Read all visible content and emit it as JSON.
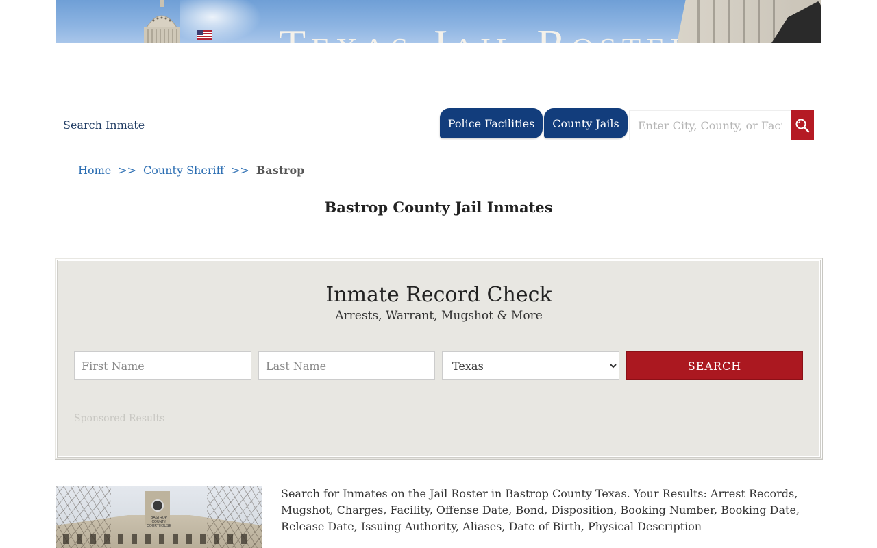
{
  "banner": {
    "title": "Texas Jail Roster"
  },
  "nav": {
    "search_inmate": "Search Inmate",
    "tabs": [
      {
        "label": "Police Facilities"
      },
      {
        "label": "County Jails"
      }
    ],
    "site_search_placeholder": "Enter City, County, or Facility"
  },
  "breadcrumb": {
    "home": "Home",
    "sep1": ">>",
    "county_sheriff": "County Sheriff",
    "sep2": ">>",
    "current": "Bastrop"
  },
  "page": {
    "title": "Bastrop County Jail Inmates"
  },
  "record_check": {
    "title": "Inmate Record Check",
    "subtitle": "Arrests, Warrant, Mugshot & More",
    "first_name_placeholder": "First Name",
    "last_name_placeholder": "Last Name",
    "state_selected": "Texas",
    "search_label": "SEARCH",
    "sponsored": "Sponsored Results"
  },
  "content": {
    "photo_sign": "BASTROP COUNTY COURTHOUSE",
    "description": "Search for Inmates on the Jail Roster in Bastrop County Texas. Your Results: Arrest Records, Mugshot, Charges, Facility, Offense Date, Bond, Disposition, Booking Number, Booking Date, Release Date, Issuing Authority, Aliases, Date of Birth, Physical Description"
  },
  "colors": {
    "nav_blue": "#123d7c",
    "accent_red": "#ab1820",
    "link_blue": "#2d6fb3",
    "panel_bg": "#e8e7e2"
  },
  "icons": {
    "site_search": "search-icon"
  }
}
